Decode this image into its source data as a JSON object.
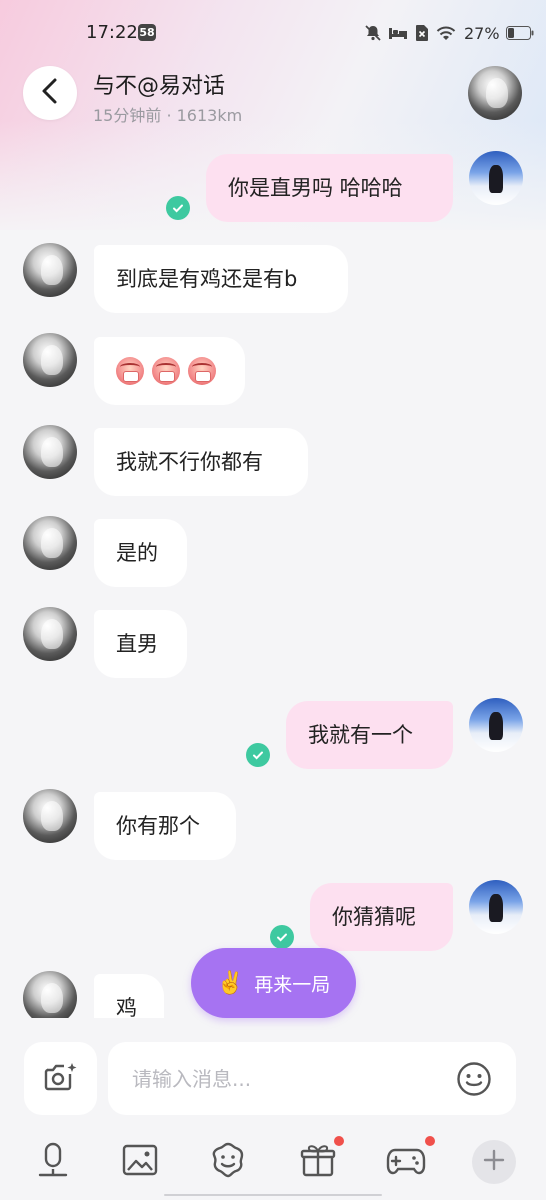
{
  "status_bar": {
    "time": "17:22",
    "badge": "58",
    "battery": "27%"
  },
  "header": {
    "title": "与不@易对话",
    "subtitle": "15分钟前 · 1613km"
  },
  "messages": [
    {
      "side": "out",
      "text": "你是直男吗 哈哈哈",
      "read": true
    },
    {
      "side": "in",
      "text": "到底是有鸡还是有b"
    },
    {
      "side": "in",
      "type": "emoji",
      "emoji_name": "angry-face-sticker",
      "count": 3
    },
    {
      "side": "in",
      "text": "我就不行你都有"
    },
    {
      "side": "in",
      "text": "是的"
    },
    {
      "side": "in",
      "text": "直男"
    },
    {
      "side": "out",
      "text": "我就有一个",
      "read": true
    },
    {
      "side": "in",
      "text": "你有那个"
    },
    {
      "side": "out",
      "text": "你猜猜呢",
      "read": true
    },
    {
      "side": "in",
      "text": "鸡"
    }
  ],
  "replay_button": {
    "label": "再来一局",
    "icon": "victory-hand-icon"
  },
  "composer": {
    "placeholder": "请输入消息...",
    "value": ""
  },
  "toolbar": {
    "items": [
      {
        "icon": "microphone-icon",
        "badge": false
      },
      {
        "icon": "image-icon",
        "badge": false
      },
      {
        "icon": "sticker-icon",
        "badge": false
      },
      {
        "icon": "gift-icon",
        "badge": true
      },
      {
        "icon": "gamepad-icon",
        "badge": true
      },
      {
        "icon": "plus-icon",
        "badge": false
      }
    ]
  },
  "colors": {
    "outgoing_bubble": "#fde0f0",
    "incoming_bubble": "#ffffff",
    "read_check": "#3ec9a0",
    "replay_button": "#a673f2",
    "badge_red": "#f0504b"
  }
}
